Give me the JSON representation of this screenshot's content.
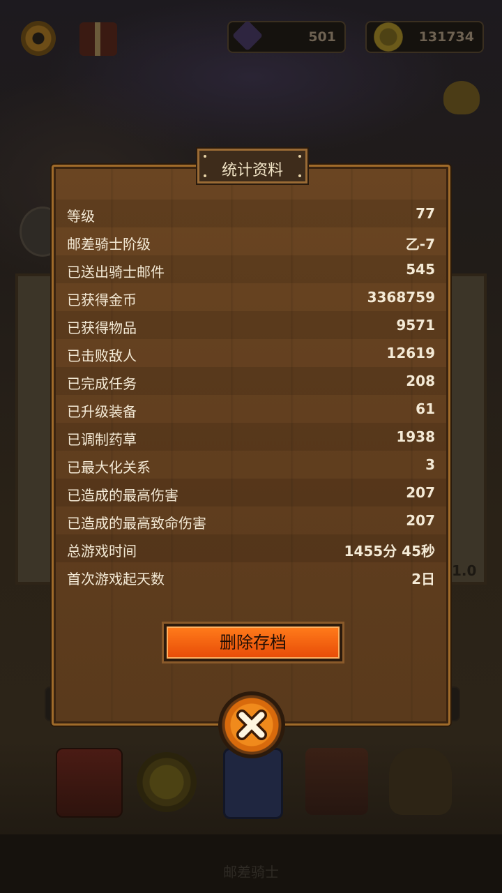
{
  "hud": {
    "gems": "501",
    "coins": "131734"
  },
  "background": {
    "version_text": "1.0",
    "bottom_title": "邮差骑士"
  },
  "modal": {
    "title": "统计资料",
    "stats": [
      {
        "label": "等级",
        "value": "77"
      },
      {
        "label": "邮差骑士阶级",
        "value": "乙-7"
      },
      {
        "label": "已送出骑士邮件",
        "value": "545"
      },
      {
        "label": "已获得金币",
        "value": "3368759"
      },
      {
        "label": "已获得物品",
        "value": "9571"
      },
      {
        "label": "已击败敌人",
        "value": "12619"
      },
      {
        "label": "已完成任务",
        "value": "208"
      },
      {
        "label": "已升级装备",
        "value": "61"
      },
      {
        "label": "已调制药草",
        "value": "1938"
      },
      {
        "label": "已最大化关系",
        "value": "3"
      },
      {
        "label": "已造成的最高伤害",
        "value": "207"
      },
      {
        "label": "已造成的最高致命伤害",
        "value": "207"
      },
      {
        "label": "总游戏时间",
        "value": "1455分 45秒"
      },
      {
        "label": "首次游戏起天数",
        "value": "2日"
      }
    ],
    "delete_label": "删除存档",
    "close_icon": "close-x-icon"
  },
  "colors": {
    "panel": "#5f3d1e",
    "border": "#a06b2a",
    "button": "#e84d08",
    "text": "#f4ead6"
  }
}
